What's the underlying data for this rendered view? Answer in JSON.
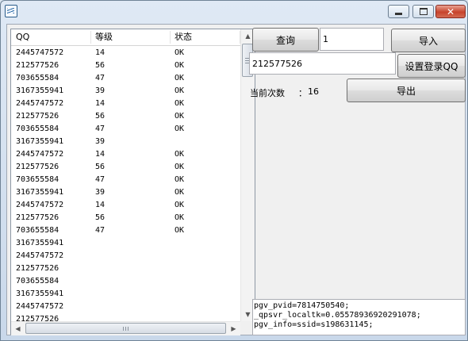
{
  "window": {
    "controls": {
      "minimize_icon": "minimize-icon",
      "maximize_icon": "maximize-icon",
      "close_icon": "close-icon"
    }
  },
  "table": {
    "columns": [
      "QQ",
      "等级",
      "状态"
    ],
    "rows": [
      [
        "2445747572",
        "14",
        "OK"
      ],
      [
        "212577526",
        "56",
        "OK"
      ],
      [
        "703655584",
        "47",
        "OK"
      ],
      [
        "3167355941",
        "39",
        "OK"
      ],
      [
        "2445747572",
        "14",
        "OK"
      ],
      [
        "212577526",
        "56",
        "OK"
      ],
      [
        "703655584",
        "47",
        "OK"
      ],
      [
        "3167355941",
        "39",
        ""
      ],
      [
        "2445747572",
        "14",
        "OK"
      ],
      [
        "212577526",
        "56",
        "OK"
      ],
      [
        "703655584",
        "47",
        "OK"
      ],
      [
        "3167355941",
        "39",
        "OK"
      ],
      [
        "2445747572",
        "14",
        "OK"
      ],
      [
        "212577526",
        "56",
        "OK"
      ],
      [
        "703655584",
        "47",
        "OK"
      ],
      [
        "3167355941",
        "",
        ""
      ],
      [
        "2445747572",
        "",
        ""
      ],
      [
        "212577526",
        "",
        ""
      ],
      [
        "703655584",
        "",
        ""
      ],
      [
        "3167355941",
        "",
        ""
      ],
      [
        "2445747572",
        "",
        ""
      ],
      [
        "212577526",
        "",
        ""
      ]
    ]
  },
  "query": {
    "button_label": "查询",
    "input_value": "1"
  },
  "import": {
    "button_label": "导入"
  },
  "account": {
    "input_value": "212577526",
    "button_label": "设置登录QQ"
  },
  "counter": {
    "label": "当前次数",
    "separator": "：",
    "value": "16"
  },
  "export": {
    "button_label": "导出"
  },
  "log": {
    "text": "pgv_pvid=7814750540;\n_qpsvr_localtk=0.05578936920291078;\npgv_info=ssid=s198631145;"
  },
  "scrollbars": {
    "up_icon": "arrow-up-icon",
    "down_icon": "arrow-down-icon",
    "left_icon": "arrow-left-icon",
    "right_icon": "arrow-right-icon"
  }
}
